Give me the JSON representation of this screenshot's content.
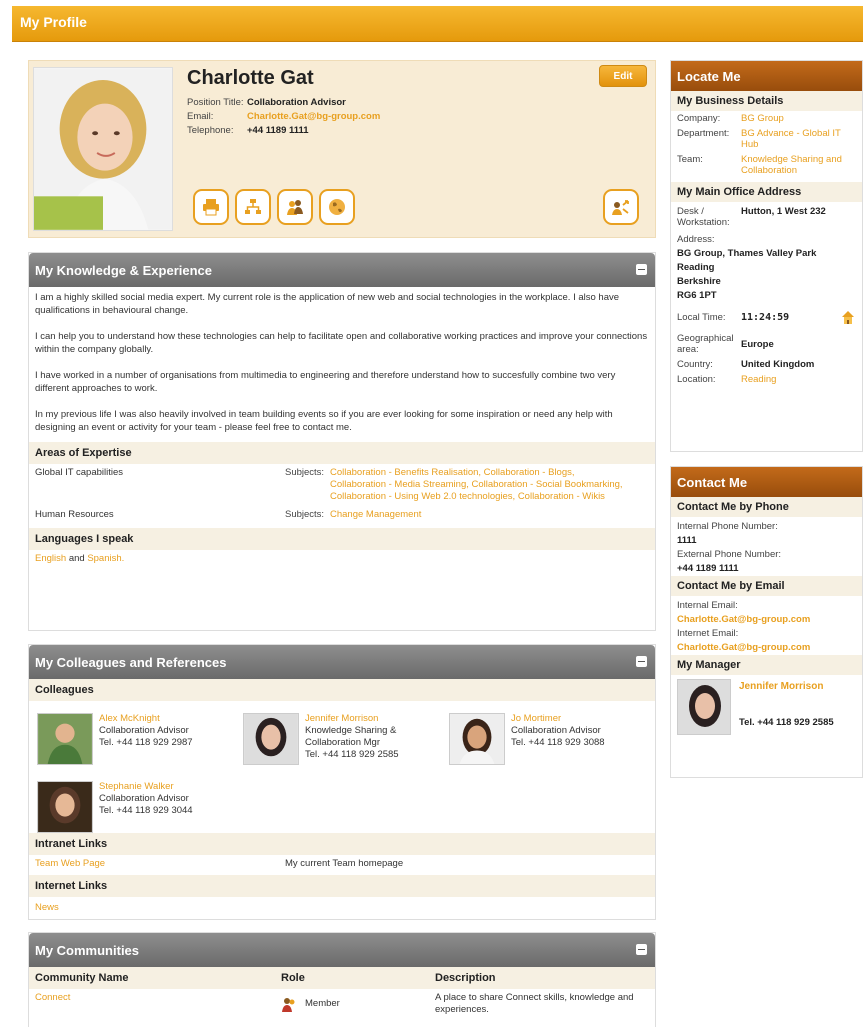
{
  "topbar": {
    "title": "My Profile"
  },
  "profile": {
    "name": "Charlotte Gat",
    "edit_label": "Edit",
    "position_label": "Position Title:",
    "position_value": "Collaboration Advisor",
    "email_label": "Email:",
    "email_value": "Charlotte.Gat@bg-group.com",
    "telephone_label": "Telephone:",
    "telephone_value": "+44 1189 1111",
    "action_icons": [
      "printer-icon",
      "org-chart-icon",
      "people-icon",
      "globe-icon",
      "user-arrows-icon"
    ]
  },
  "knowledge": {
    "title": "My Knowledge & Experience",
    "paragraphs": [
      "I am a highly skilled social media expert. My current role is the application of new web and social technologies in the workplace. I also have qualifications in behavioural change.",
      "I can help you to understand how these technologies can help to facilitate open and collaborative working practices and improve your connections within the company globally.",
      "I have worked in a number of organisations from multimedia to engineering and therefore understand how to succesfully combine two very different approaches to work.",
      "In my previous life I was also heavily involved in team building events so if you are ever looking for some inspiration or need any help with designing an event or activity for your team - please feel free to contact me."
    ],
    "expertise_title": "Areas of Expertise",
    "expertise": [
      {
        "area": "Global IT capabilities",
        "subjects_label": "Subjects:",
        "subjects": "Collaboration - Benefits Realisation, Collaboration - Blogs, Collaboration - Media Streaming, Collaboration - Social Bookmarking, Collaboration - Using Web 2.0 technologies, Collaboration - Wikis"
      },
      {
        "area": "Human Resources",
        "subjects_label": "Subjects:",
        "subjects": "Change Management"
      }
    ],
    "languages_title": "Languages I speak",
    "lang1": "English",
    "lang_and": "and",
    "lang2": "Spanish."
  },
  "colleagues": {
    "title": "My Colleagues and References",
    "subhead": "Colleagues",
    "items": [
      {
        "name": "Alex McKnight",
        "role": "Collaboration Advisor",
        "tel": "Tel. +44 118 929 2987"
      },
      {
        "name": "Jennifer Morrison",
        "role": "Knowledge Sharing & Collaboration Mgr",
        "tel": "Tel. +44 118 929 2585"
      },
      {
        "name": "Jo Mortimer",
        "role": "Collaboration Advisor",
        "tel": "Tel. +44 118 929 3088"
      },
      {
        "name": "Stephanie Walker",
        "role": "Collaboration Advisor",
        "tel": "Tel. +44 118 929 3044"
      }
    ],
    "intranet_title": "Intranet Links",
    "intranet_link": "Team Web Page",
    "intranet_desc": "My current Team homepage",
    "internet_title": "Internet Links",
    "internet_link": "News"
  },
  "communities": {
    "title": "My Communities",
    "col_name": "Community Name",
    "col_role": "Role",
    "col_desc": "Description",
    "row_name": "Connect",
    "row_role": "Member",
    "row_desc": "A place to share Connect skills, knowledge and experiences."
  },
  "locate": {
    "title": "Locate Me",
    "business_title": "My Business Details",
    "company_label": "Company:",
    "company_value": "BG Group",
    "dept_label": "Department:",
    "dept_value": "BG Advance - Global IT Hub",
    "team_label": "Team:",
    "team_value": "Knowledge Sharing and Collaboration",
    "office_title": "My Main Office Address",
    "desk_label": "Desk / Workstation:",
    "desk_value": "Hutton, 1 West 232",
    "address_label": "Address:",
    "address_lines": [
      "BG Group, Thames Valley Park",
      "Reading",
      "Berkshire",
      "RG6 1PT"
    ],
    "time_label": "Local Time:",
    "time_value": "11:24:59",
    "geo_label": "Geographical area:",
    "geo_value": "Europe",
    "country_label": "Country:",
    "country_value": "United Kingdom",
    "location_label": "Location:",
    "location_value": "Reading"
  },
  "contact": {
    "title": "Contact Me",
    "phone_title": "Contact Me by Phone",
    "internal_phone_label": "Internal Phone Number:",
    "internal_phone_value": "1111",
    "external_phone_label": "External Phone Number:",
    "external_phone_value": "+44 1189 1111",
    "email_title": "Contact Me by Email",
    "internal_email_label": "Internal Email:",
    "internal_email_value": "Charlotte.Gat@bg-group.com",
    "internet_email_label": "Internet Email:",
    "internet_email_value": "Charlotte.Gat@bg-group.com",
    "manager_title": "My Manager",
    "manager_name": "Jennifer Morrison",
    "manager_tel": "Tel. +44 118 929 2585"
  }
}
